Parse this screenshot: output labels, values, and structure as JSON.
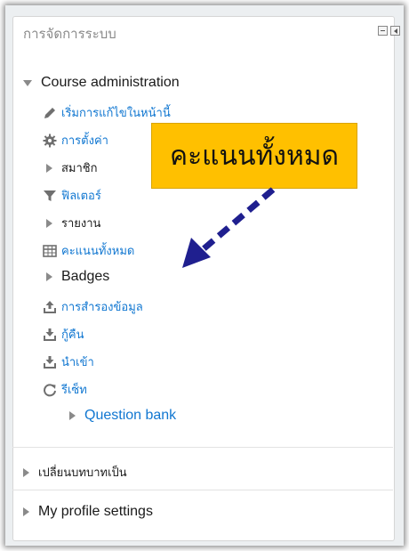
{
  "block": {
    "title": "การจัดการระบบ",
    "controls": {
      "minimize_icon": "minus-box",
      "dock_icon": "dock-left"
    }
  },
  "menu": {
    "course_admin": {
      "label": "Course administration"
    },
    "items": [
      {
        "label": "เริ่มการแก้ไขในหน้านี้",
        "icon": "pencil"
      },
      {
        "label": "การตั้งค่า",
        "icon": "gear"
      },
      {
        "label": "สมาชิก",
        "icon": "caret-right"
      },
      {
        "label": "ฟิลเตอร์",
        "icon": "filter"
      },
      {
        "label": "รายงาน",
        "icon": "caret-right"
      },
      {
        "label": "คะแนนทั้งหมด",
        "icon": "table"
      },
      {
        "label": "Badges",
        "icon": "caret-right"
      },
      {
        "label": "การสำรองข้อมูล",
        "icon": "upload"
      },
      {
        "label": "กู้คืน",
        "icon": "download"
      },
      {
        "label": "นำเข้า",
        "icon": "download"
      },
      {
        "label": "รีเซ็ท",
        "icon": "refresh"
      },
      {
        "label": "Question bank",
        "icon": "caret-right"
      }
    ],
    "switch_role": {
      "label": "เปลี่ยนบทบาทเป็น"
    },
    "profile": {
      "label": "My profile settings"
    }
  },
  "callout": {
    "text": "คะแนนทั้งหมด",
    "color": "#ffc000"
  },
  "colors": {
    "link": "#1177d1",
    "arrow": "#1f1f8f"
  }
}
